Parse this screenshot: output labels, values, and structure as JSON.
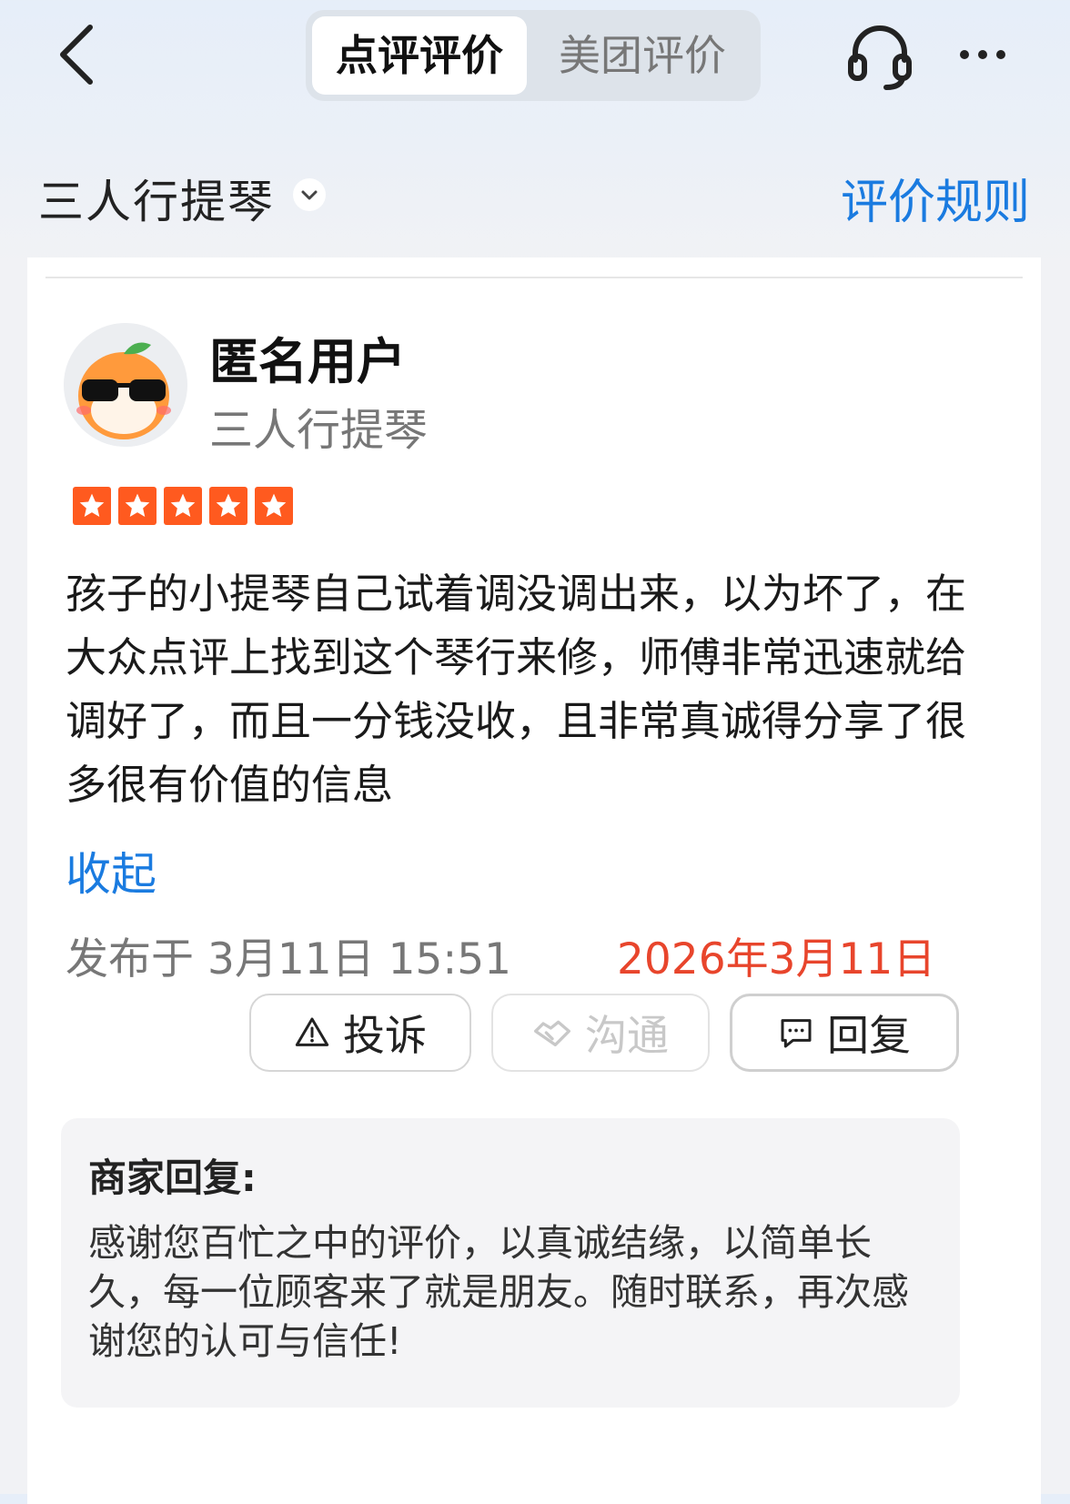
{
  "header": {
    "tabs": [
      {
        "label": "点评评价",
        "active": true
      },
      {
        "label": "美团评价",
        "active": false
      }
    ],
    "icons": {
      "back": "back-arrow-icon",
      "support": "headset-icon",
      "more": "more-icon"
    }
  },
  "shop_bar": {
    "shop_name": "三人行提琴",
    "rules_link": "评价规则"
  },
  "review": {
    "user_name": "匿名用户",
    "shop_name": "三人行提琴",
    "rating": 5,
    "text": "孩子的小提琴自己试着调没调出来，以为坏了，在大众点评上找到这个琴行来修，师傅非常迅速就给调好了，而且一分钱没收，且非常真诚得分享了很多很有价值的信息",
    "collapse_label": "收起",
    "published": "发布于 3月11日 15:51",
    "date_stamp": "2026年3月11日"
  },
  "actions": {
    "complain": "投诉",
    "chat": "沟通",
    "reply": "回复"
  },
  "merchant_reply": {
    "title": "商家回复:",
    "text": "感谢您百忙之中的评价，以真诚结缘，以简单长久，每一位顾客来了就是朋友。随时联系，再次感谢您的认可与信任!"
  },
  "colors": {
    "accent_blue": "#1a7be0",
    "star_orange": "#ff5a1f",
    "stamp_red": "#e8452c"
  }
}
